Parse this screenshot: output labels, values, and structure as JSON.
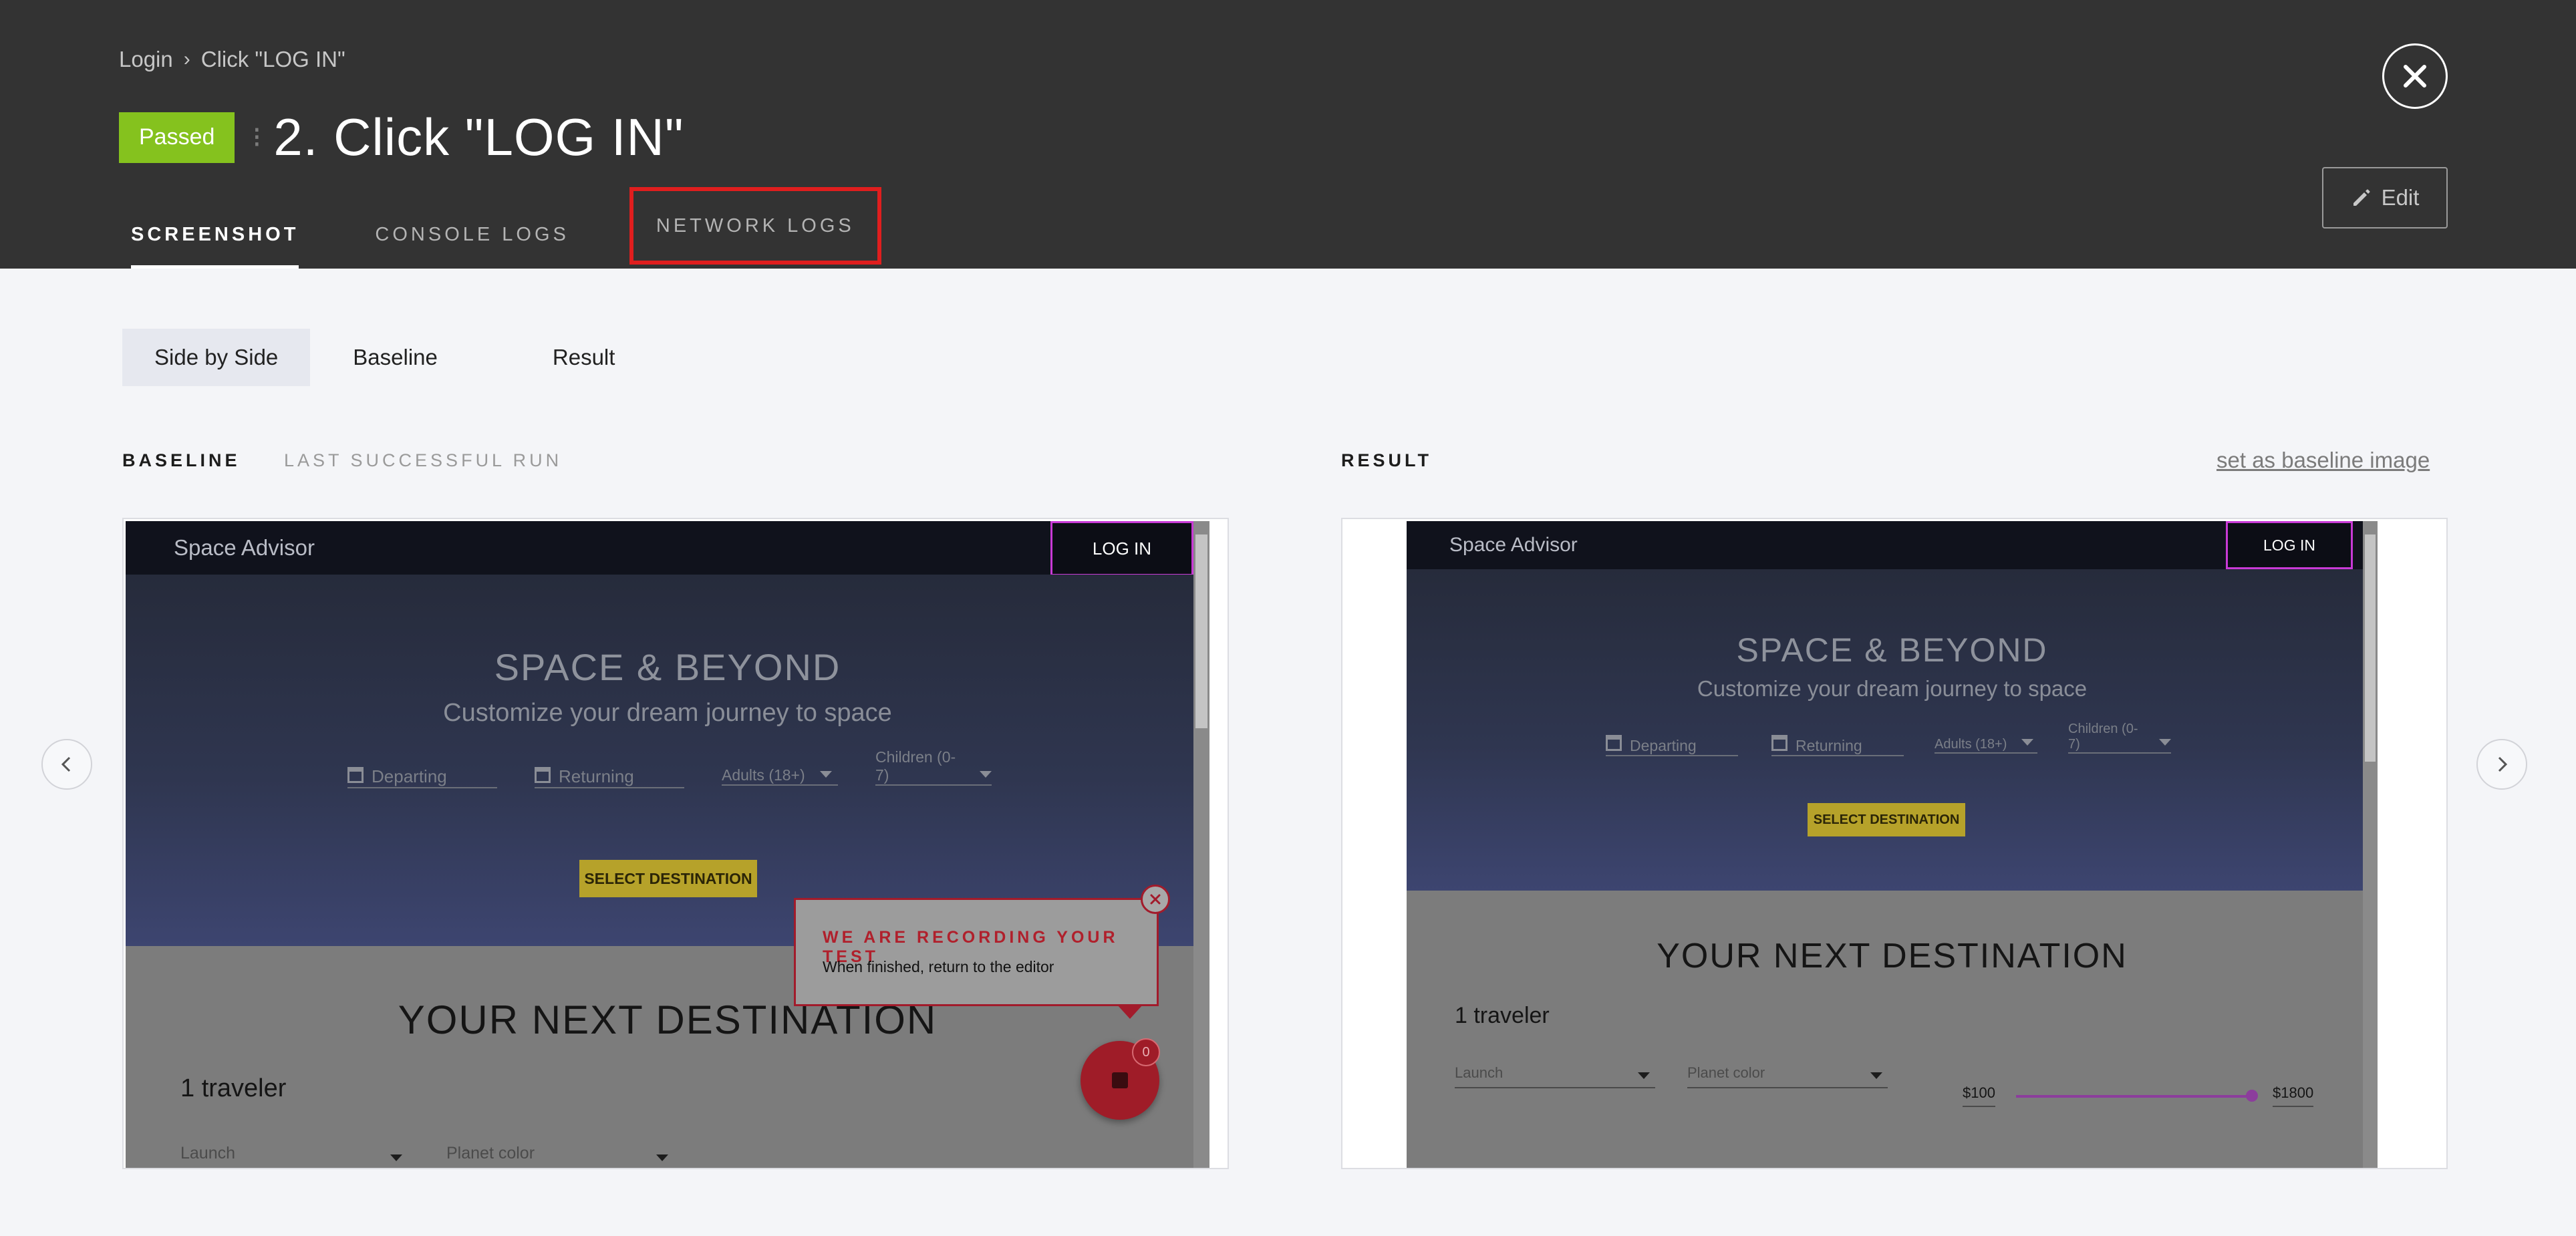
{
  "breadcrumb": {
    "root": "Login",
    "current": "Click \"LOG IN\""
  },
  "status_badge": "Passed",
  "step_title": "2. Click \"LOG IN\"",
  "tabs": [
    {
      "label": "SCREENSHOT"
    },
    {
      "label": "CONSOLE LOGS"
    },
    {
      "label": "NETWORK LOGS"
    }
  ],
  "edit_label": "Edit",
  "view_modes": [
    {
      "label": "Side by Side"
    },
    {
      "label": "Baseline"
    },
    {
      "label": "Result"
    }
  ],
  "baseline_label": "BASELINE",
  "last_run_label": "LAST SUCCESSFUL RUN",
  "result_label": "RESULT",
  "set_baseline_link": "set as baseline image",
  "app": {
    "brand": "Space Advisor",
    "login": "LOG IN",
    "headline": "SPACE & BEYOND",
    "subhead": "Customize your dream journey to space",
    "departing": "Departing",
    "returning": "Returning",
    "adults": "Adults (18+)",
    "children": "Children (0-7)",
    "select_destination": "SELECT DESTINATION",
    "next_destination": "YOUR NEXT DESTINATION",
    "travelers": "1 traveler",
    "launch": "Launch",
    "planet_color": "Planet color",
    "price_min": "$100",
    "price_max": "$1800"
  },
  "recording": {
    "title": "WE ARE RECORDING YOUR TEST",
    "subtitle": "When finished, return to the editor",
    "count": "0"
  },
  "colors": {
    "header_bg": "#333333",
    "passed": "#85c21e",
    "highlight_red": "#e01e1e",
    "login_outline": "#c93ad6",
    "record_red": "#9f1c28"
  }
}
